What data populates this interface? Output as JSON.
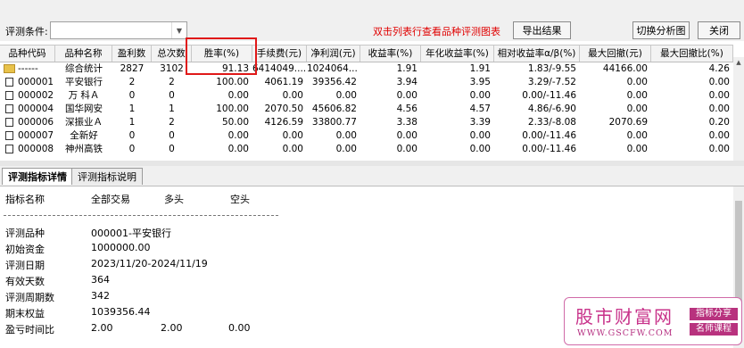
{
  "toolbar": {
    "condition_label": "评测条件:",
    "condition_value": "",
    "hint": "双击列表行查看品种评测图表",
    "export_label": "导出结果",
    "switch_label": "切换分析图",
    "close_label": "关闭"
  },
  "table": {
    "headers": [
      "品种代码",
      "品种名称",
      "盈利数",
      "总次数",
      "胜率(%)",
      "手续费(元)",
      "净利润(元)",
      "收益率(%)",
      "年化收益率(%)",
      "相对收益率α/β(%)",
      "最大回撤(元)",
      "最大回撤比(%)"
    ],
    "rows": [
      [
        "------",
        "综合统计",
        "2827",
        "3102",
        "91.13",
        "6414049....",
        "1024064...",
        "1.91",
        "1.91",
        "1.83/-9.55",
        "44166.00",
        "4.26"
      ],
      [
        "000001",
        "平安银行",
        "2",
        "2",
        "100.00",
        "4061.19",
        "39356.42",
        "3.94",
        "3.95",
        "3.29/-7.52",
        "0.00",
        "0.00"
      ],
      [
        "000002",
        "万 科Ａ",
        "0",
        "0",
        "0.00",
        "0.00",
        "0.00",
        "0.00",
        "0.00",
        "0.00/-11.46",
        "0.00",
        "0.00"
      ],
      [
        "000004",
        "国华网安",
        "1",
        "1",
        "100.00",
        "2070.50",
        "45606.82",
        "4.56",
        "4.57",
        "4.86/-6.90",
        "0.00",
        "0.00"
      ],
      [
        "000006",
        "深振业Ａ",
        "1",
        "2",
        "50.00",
        "4126.59",
        "33800.77",
        "3.38",
        "3.39",
        "2.33/-8.08",
        "2070.69",
        "0.20"
      ],
      [
        "000007",
        "全新好",
        "0",
        "0",
        "0.00",
        "0.00",
        "0.00",
        "0.00",
        "0.00",
        "0.00/-11.46",
        "0.00",
        "0.00"
      ],
      [
        "000008",
        "神州高铁",
        "0",
        "0",
        "0.00",
        "0.00",
        "0.00",
        "0.00",
        "0.00",
        "0.00/-11.46",
        "0.00",
        "0.00"
      ],
      [
        "",
        "",
        "",
        "",
        "",
        "",
        "",
        "",
        "",
        "",
        "",
        ""
      ]
    ]
  },
  "tabs": [
    "评测指标详情",
    "评测指标说明"
  ],
  "detail": {
    "col_headers": [
      "指标名称",
      "全部交易",
      "多头",
      "空头"
    ],
    "items": [
      {
        "label": "评测品种",
        "v1": "000001-平安银行",
        "v2": "",
        "v3": ""
      },
      {
        "label": "初始资金",
        "v1": "1000000.00",
        "v2": "",
        "v3": ""
      },
      {
        "label": "评测日期",
        "v1": "2023/11/20-2024/11/19",
        "v2": "",
        "v3": ""
      },
      {
        "label": "有效天数",
        "v1": "364",
        "v2": "",
        "v3": ""
      },
      {
        "label": "评测周期数",
        "v1": "342",
        "v2": "",
        "v3": ""
      },
      {
        "label": "期末权益",
        "v1": "1039356.44",
        "v2": "",
        "v3": ""
      },
      {
        "label": "盈亏时间比",
        "v1": "2.00",
        "v2": "2.00",
        "v3": "0.00"
      }
    ]
  },
  "watermark": {
    "title": "股市财富网",
    "url": "WWW.GSCFW.COM",
    "tag1": "指标分享",
    "tag2": "名师课程"
  },
  "colors": {
    "highlight": "#e01818",
    "hint": "#e00000",
    "watermark": "#c8328a"
  }
}
